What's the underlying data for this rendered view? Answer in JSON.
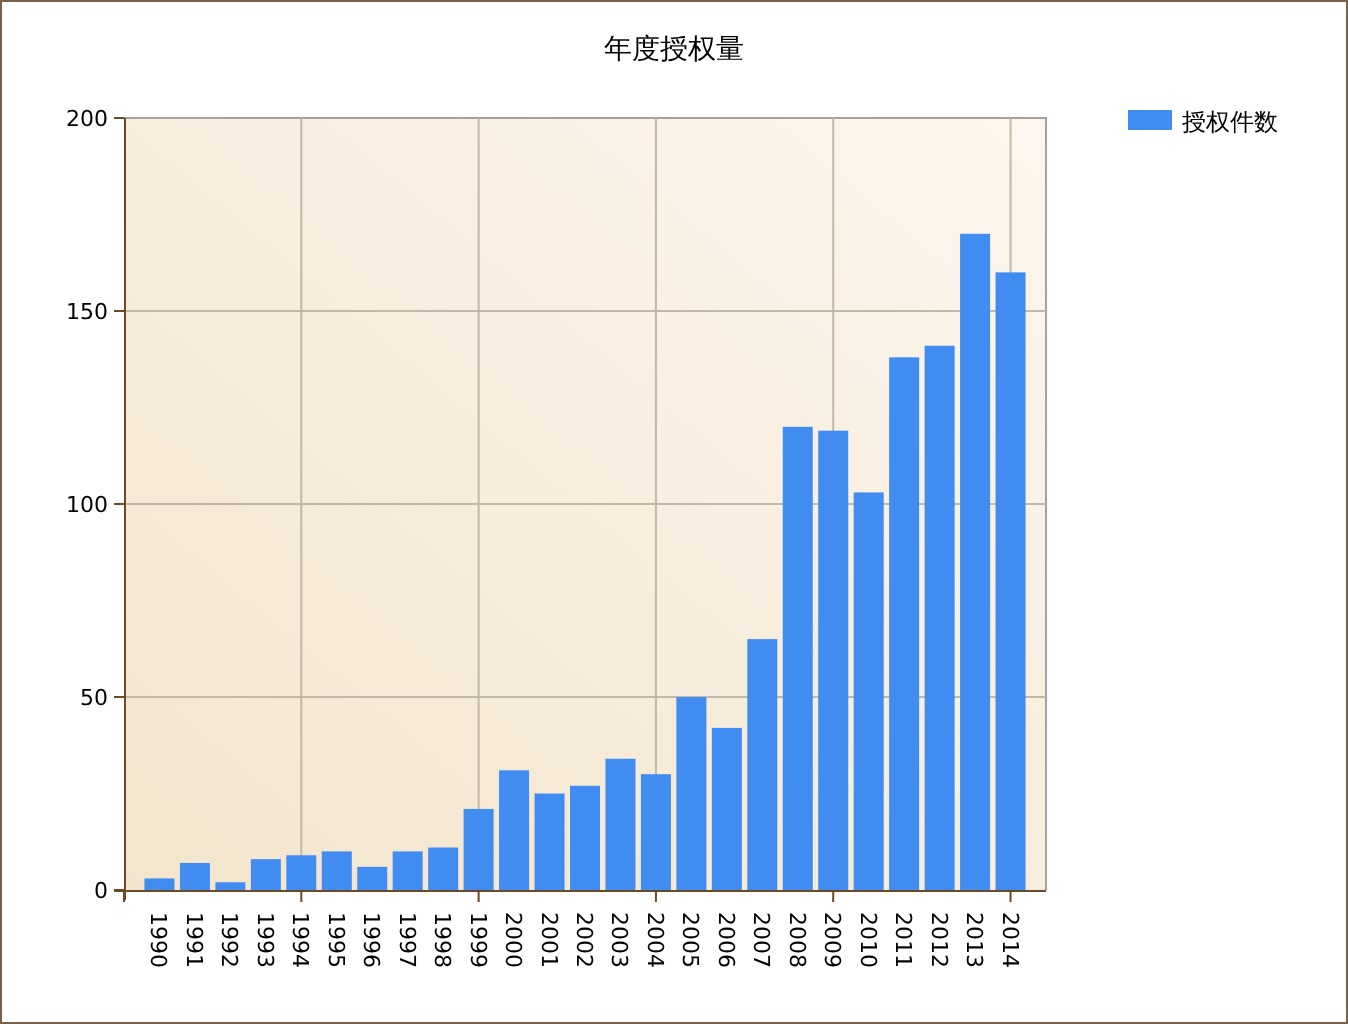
{
  "chart": {
    "chart_data": {
      "type": "bar",
      "title": "年度授权量",
      "categories": [
        "1990",
        "1991",
        "1992",
        "1993",
        "1994",
        "1995",
        "1996",
        "1997",
        "1998",
        "1999",
        "2000",
        "2001",
        "2002",
        "2003",
        "2004",
        "2005",
        "2006",
        "2007",
        "2008",
        "2009",
        "2010",
        "2011",
        "2012",
        "2013",
        "2014"
      ],
      "series": [
        {
          "name": "授权件数",
          "color": "#418cf0",
          "values": [
            3,
            7,
            2,
            8,
            9,
            10,
            6,
            10,
            11,
            21,
            31,
            25,
            27,
            34,
            30,
            50,
            42,
            65,
            120,
            119,
            103,
            138,
            141,
            170,
            160
          ]
        }
      ],
      "ylim": [
        0,
        200
      ],
      "grid": true,
      "yticks": [
        0,
        50,
        100,
        150,
        200
      ]
    }
  }
}
